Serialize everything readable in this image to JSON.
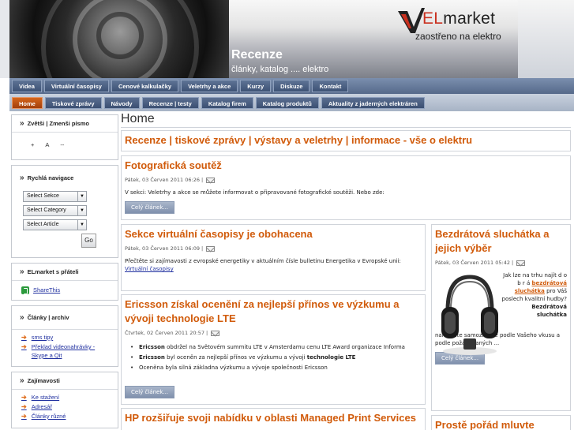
{
  "header": {
    "logo_brand_prefix": "EL",
    "logo_brand_suffix": "market",
    "slogan": "zaostřeno na elektro",
    "section_title": "Recenze",
    "section_subtitle": "články, katalog .... elektro"
  },
  "nav_primary": [
    "Videa",
    "Virtuální časopisy",
    "Cenové kalkulačky",
    "Veletrhy a akce",
    "Kurzy",
    "Diskuze",
    "Kontakt"
  ],
  "nav_secondary": [
    "Home",
    "Tiskové zprávy",
    "Návody",
    "Recenze | testy",
    "Katalog firem",
    "Katalog produktů",
    "Aktuality z jaderných elektráren"
  ],
  "sidebar": {
    "fontsize": {
      "title": "Zvětši | Zmenši písmo",
      "plus": "+",
      "reset": "A",
      "minus": "--"
    },
    "quicknav": {
      "title": "Rychlá navigace",
      "section": "Select Sekce",
      "category": "Select Category",
      "article": "Select Article",
      "go": "Go"
    },
    "share": {
      "title": "ELmarket s přáteli",
      "link": "ShareThis"
    },
    "archive": {
      "title": "Články | archiv",
      "links": [
        "sms tipy",
        "Překlad videonahrávky - Skype a Qit"
      ]
    },
    "interesting": {
      "title": "Zajímavosti",
      "links": [
        "Ke stažení",
        "Adresář",
        "Články různé"
      ]
    }
  },
  "page_title": "Home",
  "intro_box": {
    "title": "Recenze | tiskové zprávy | výstavy a veletrhy | informace - vše o elektru"
  },
  "articles": [
    {
      "title": "Fotografická soutěž",
      "meta": "Pátek, 03 Červen 2011 06:26 |",
      "text": "V sekci: Veletrhy a akce se můžete informovat o připravované fotografické soutěži. Nebo zde:",
      "more": "Celý článek..."
    },
    {
      "title": "Sekce virtuální časopisy je obohacena",
      "meta": "Pátek, 03 Červen 2011 06:09 |",
      "text": "Přečtěte si zajímavosti z evropské energetiky v aktuálním čísle bulletinu Energetika v Evropské unii:",
      "link": "Virtuální časopisy"
    },
    {
      "title": "Ericsson získal ocenění za nejlepší přínos ve výzkumu a vývoji technologie LTE",
      "meta": "Čtvrtek, 02 Červen 2011 20:57 |",
      "bullets": [
        {
          "bold": "Ericsson",
          "text": " obdržel na Světovém summitu LTE v Amsterdamu cenu LTE Award organizace Informa"
        },
        {
          "bold": "Ericsson",
          "text": " byl oceněn za nejlepší přínos ve výzkumu a vývoji ",
          "bold2": "technologie LTE"
        },
        {
          "bold": "",
          "text": "Oceněna byla silná základna výzkumu a vývoje společnosti Ericsson"
        }
      ],
      "more": "Celý článek..."
    },
    {
      "title": "HP rozšiřuje svoji nabídku v oblasti Managed Print Services"
    }
  ],
  "right_articles": [
    {
      "title": "Bezdrátová sluchátka a jejich výběr",
      "meta": "Pátek, 03 Červen 2011 05:42 |",
      "text_a": "Jak lze na trhu najít d o b r á",
      "link": "bezdrátová sluchátka",
      "text_b": "pro Váš poslech kvalitní hudby?",
      "bold": "Bezdrátová sluchátka",
      "text_c": "nakoupíte samozřejmě podle Vašeho vkusu a podle požadovaných ...",
      "more": "Celý článek..."
    },
    {
      "title": "Prostě pořád mluvte"
    }
  ]
}
